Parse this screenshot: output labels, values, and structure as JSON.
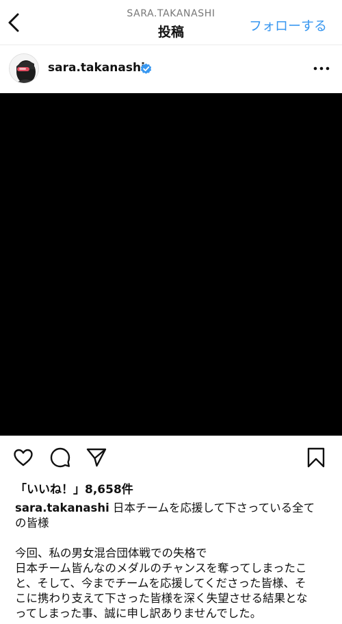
{
  "header": {
    "account": "SARA.TAKANASHI",
    "title": "投稿",
    "follow_label": "フォローする"
  },
  "post": {
    "username": "sara.takanashi",
    "verified": true,
    "likes_text": "「いいね！」8,658件",
    "caption": {
      "username": "sara.takanashi",
      "line1": "日本チームを応援して下さっている全て",
      "line2": "の皆様",
      "line3": "今回、私の男女混合団体戦での失格で",
      "line4": "日本チーム皆んなのメダルのチャンスを奪ってしまったこ",
      "line5": "と、そして、今までチームを応援してくださった皆様、そ",
      "line6": "こに携わり支えて下さった皆様を深く失望させる結果とな",
      "line7": "ってしまった事、誠に申し訳ありませんでした。"
    }
  },
  "icons": {
    "back": "chevron-left-icon",
    "verified": "verified-badge-icon",
    "more": "more-horizontal-icon",
    "like": "heart-icon",
    "comment": "comment-icon",
    "share": "paper-plane-icon",
    "save": "bookmark-icon"
  },
  "colors": {
    "accent": "#3897f0",
    "verified": "#3897f0",
    "media_background": "#000000",
    "text": "#111111",
    "subtle_text": "#777777"
  }
}
